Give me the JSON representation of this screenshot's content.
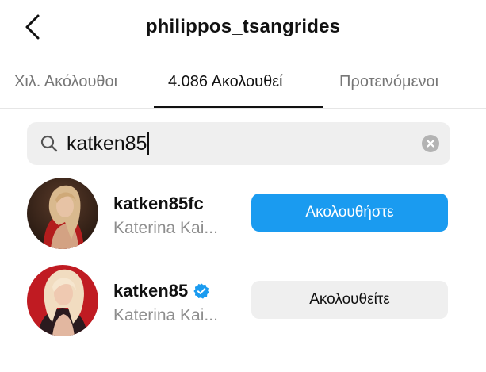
{
  "header": {
    "title": "philippos_tsangrides",
    "back_icon": "chevron-left-icon"
  },
  "tabs": [
    {
      "label": "Χιλ. Ακόλουθοι",
      "active": false
    },
    {
      "label": "4.086 Ακολουθεί",
      "active": true
    },
    {
      "label": "Προτεινόμενοι",
      "active": false
    }
  ],
  "search": {
    "value": "katken85",
    "search_icon": "search-icon",
    "clear_icon": "clear-icon"
  },
  "results": [
    {
      "username": "katken85fc",
      "full_name": "Katerina Kai...",
      "verified": false,
      "button_label": "Ακολουθήστε",
      "button_style": "primary"
    },
    {
      "username": "katken85",
      "full_name": "Katerina Kai...",
      "verified": true,
      "button_label": "Ακολουθείτε",
      "button_style": "secondary"
    }
  ],
  "colors": {
    "accent": "#1a9bf0",
    "secondary_button": "#efefef",
    "muted_text": "#8e8e8e"
  }
}
